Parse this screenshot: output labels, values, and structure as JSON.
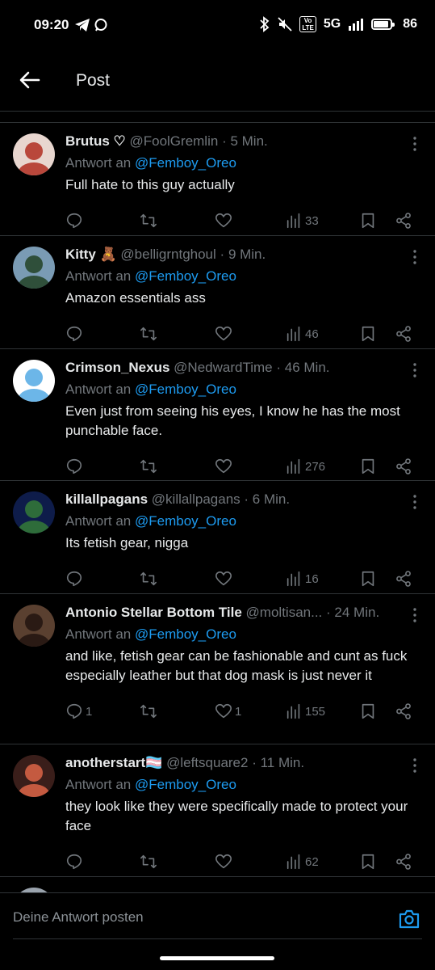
{
  "status_bar": {
    "time": "09:20",
    "network": "5G",
    "lte_label": "Vo LTE",
    "battery": "86"
  },
  "header": {
    "title": "Post"
  },
  "colors": {
    "accent": "#1d9bf0",
    "muted": "#71767b",
    "background": "#000000",
    "divider": "#2f3336"
  },
  "replies": [
    {
      "name": "Brutus ♡",
      "handle": "@FoolGremlin",
      "time": "5 Min.",
      "reply_prefix": "Antwort an",
      "reply_to": "@Femboy_Oreo",
      "text": "Full hate to this guy actually",
      "comments": "",
      "retweets": "",
      "likes": "",
      "views": "33"
    },
    {
      "name": "Kitty 🧸",
      "handle": "@belligrntghoul",
      "time": "9 Min.",
      "reply_prefix": "Antwort an",
      "reply_to": "@Femboy_Oreo",
      "text": "Amazon essentials ass",
      "comments": "",
      "retweets": "",
      "likes": "",
      "views": "46"
    },
    {
      "name": "Crimson_Nexus",
      "handle": "@NedwardTime",
      "time": "46 Min.",
      "reply_prefix": "Antwort an",
      "reply_to": "@Femboy_Oreo",
      "text": "Even just from seeing his eyes, I know he has the most punchable face.",
      "comments": "",
      "retweets": "",
      "likes": "",
      "views": "276"
    },
    {
      "name": "killallpagans",
      "handle": "@killallpagans",
      "time": "6 Min.",
      "reply_prefix": "Antwort an",
      "reply_to": "@Femboy_Oreo",
      "text": "Its fetish gear, nigga",
      "comments": "",
      "retweets": "",
      "likes": "",
      "views": "16"
    },
    {
      "name": "Antonio Stellar Bottom Tile",
      "handle": "@moltisan...",
      "time": "24 Min.",
      "reply_prefix": "Antwort an",
      "reply_to": "@Femboy_Oreo",
      "text": "and like, fetish gear can be fashionable and cunt as fuck especially leather but that dog mask is just never it",
      "comments": "1",
      "retweets": "",
      "likes": "1",
      "views": "155"
    },
    {
      "name": "anotherstart🏳️‍⚧️",
      "handle": "@leftsquare2",
      "time": "11 Min.",
      "reply_prefix": "Antwort an",
      "reply_to": "@Femboy_Oreo",
      "text": "they look like they were specifically made to protect your face",
      "comments": "",
      "retweets": "",
      "likes": "",
      "views": "62"
    }
  ],
  "reply_box": {
    "placeholder": "Deine Antwort posten"
  },
  "icons": {
    "back": "arrow-left-icon",
    "more": "more-vertical-icon",
    "comment": "comment-icon",
    "retweet": "retweet-icon",
    "like": "heart-icon",
    "views": "bar-chart-icon",
    "bookmark": "bookmark-icon",
    "share": "share-icon",
    "camera": "camera-icon"
  }
}
